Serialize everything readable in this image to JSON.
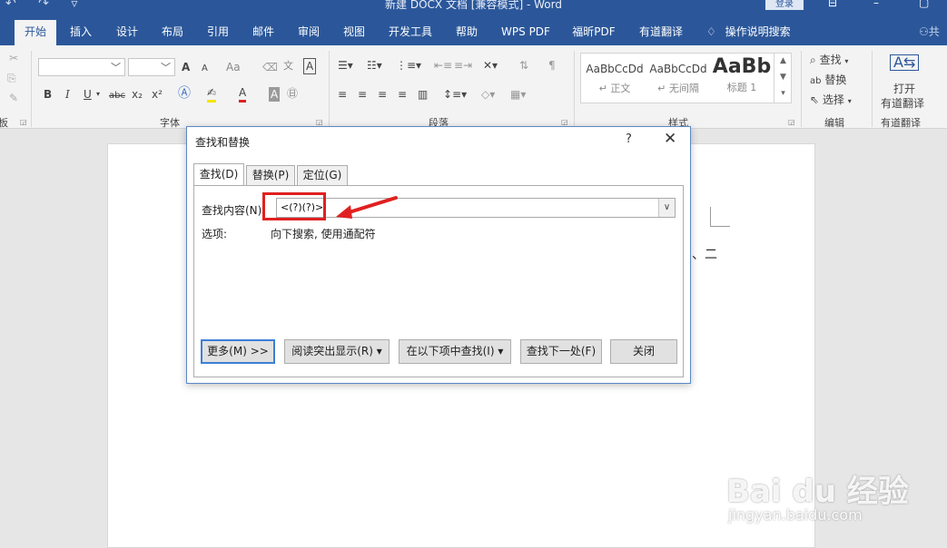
{
  "app": {
    "title": "新建 DOCX 文档 [兼容模式] - Word",
    "login_label": "登录",
    "qat_icons": [
      "undo-icon",
      "redo-icon",
      "customize-qat-icon"
    ]
  },
  "tabs": [
    {
      "label": "开始",
      "active": true
    },
    {
      "label": "插入"
    },
    {
      "label": "设计"
    },
    {
      "label": "布局"
    },
    {
      "label": "引用"
    },
    {
      "label": "邮件"
    },
    {
      "label": "审阅"
    },
    {
      "label": "视图"
    },
    {
      "label": "开发工具"
    },
    {
      "label": "帮助"
    },
    {
      "label": "WPS PDF"
    },
    {
      "label": "福昕PDF"
    },
    {
      "label": "有道翻译"
    }
  ],
  "tell_me": "操作说明搜索",
  "share_label": "共",
  "ribbon": {
    "font_group": "字体",
    "paragraph_group": "段落",
    "styles_group": "样式",
    "editing_group": "编辑",
    "youdao_group": "有道翻译",
    "font_buttons": {
      "bold": "B",
      "italic": "I",
      "underline": "U",
      "strike": "abc",
      "sub": "x₂",
      "sup": "x²",
      "grow": "A",
      "shrink": "A",
      "case": "Aa"
    },
    "styles": [
      {
        "preview": "AaBbCcDd",
        "name": "正文"
      },
      {
        "preview": "AaBbCcDd",
        "name": "无间隔"
      },
      {
        "preview": "AaBb",
        "name": "标题 1"
      }
    ],
    "editing": {
      "find": "查找",
      "replace": "替换",
      "select": "选择"
    },
    "youdao": {
      "open_line1": "打开",
      "open_line2": "有道翻译"
    }
  },
  "document": {
    "text": "、二"
  },
  "dialog": {
    "title": "查找和替换",
    "help": "?",
    "tabs": [
      {
        "label": "查找(D)",
        "active": true
      },
      {
        "label": "替换(P)"
      },
      {
        "label": "定位(G)"
      }
    ],
    "find_label": "查找内容(N):",
    "find_value": "<(?)(?)>",
    "options_label": "选项:",
    "options_value": "向下搜索, 使用通配符",
    "buttons": {
      "more": "更多(M) >>",
      "reading_highlight": "阅读突出显示(R) ▾",
      "find_in": "在以下项中查找(I) ▾",
      "find_next": "查找下一处(F)",
      "close": "关闭"
    }
  },
  "watermark": {
    "brand": "Bai du 经验",
    "url": "jingyan.baidu.com"
  },
  "colors": {
    "accent": "#2b579a",
    "highlight": "#e02020",
    "focus": "#3c7fd6"
  }
}
